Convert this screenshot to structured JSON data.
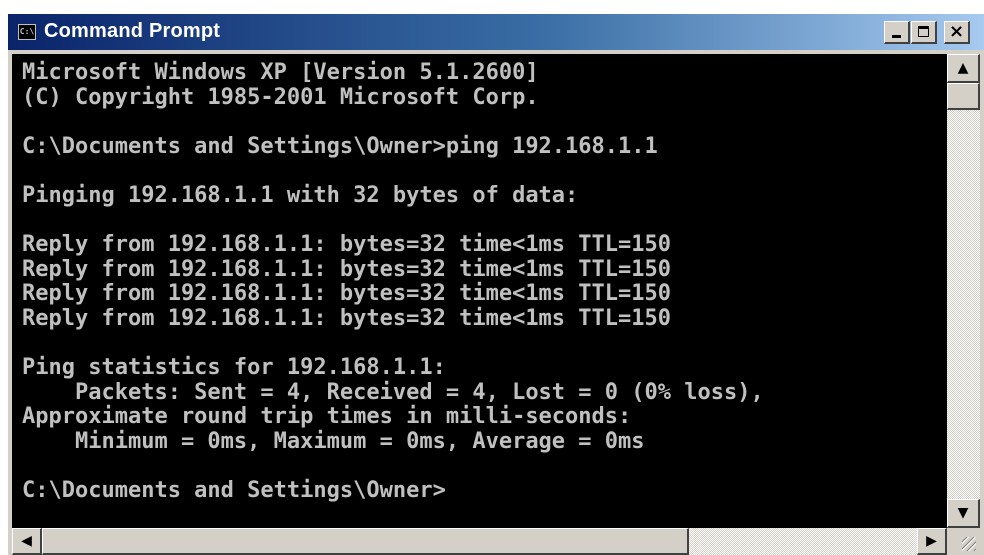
{
  "window": {
    "title": "Command Prompt",
    "icon_label": "C:\\",
    "controls": {
      "minimize": "minimize-icon",
      "maximize": "maximize-icon",
      "close": "×"
    }
  },
  "console": {
    "lines": [
      "Microsoft Windows XP [Version 5.1.2600]",
      "(C) Copyright 1985-2001 Microsoft Corp.",
      "",
      "C:\\Documents and Settings\\Owner>ping 192.168.1.1",
      "",
      "Pinging 192.168.1.1 with 32 bytes of data:",
      "",
      "Reply from 192.168.1.1: bytes=32 time<1ms TTL=150",
      "Reply from 192.168.1.1: bytes=32 time<1ms TTL=150",
      "Reply from 192.168.1.1: bytes=32 time<1ms TTL=150",
      "Reply from 192.168.1.1: bytes=32 time<1ms TTL=150",
      "",
      "Ping statistics for 192.168.1.1:",
      "    Packets: Sent = 4, Received = 4, Lost = 0 (0% loss),",
      "Approximate round trip times in milli-seconds:",
      "    Minimum = 0ms, Maximum = 0ms, Average = 0ms",
      "",
      "C:\\Documents and Settings\\Owner>"
    ]
  },
  "scrollbars": {
    "up_arrow": "▲",
    "down_arrow": "▼",
    "left_arrow": "◀",
    "right_arrow": "▶"
  },
  "colors": {
    "console_bg": "#000000",
    "console_text": "#c0c0c0",
    "titlebar_start": "#0a246a",
    "titlebar_end": "#a6caf0",
    "chrome": "#d4d0c8"
  }
}
